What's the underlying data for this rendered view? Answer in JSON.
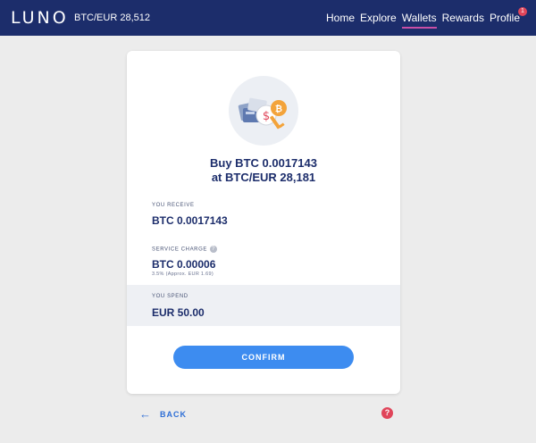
{
  "nav": {
    "logo": "LUNO",
    "ticker": "BTC/EUR 28,512",
    "links": [
      "Home",
      "Explore",
      "Wallets",
      "Rewards",
      "Profile"
    ],
    "active": "Wallets",
    "profile_badge": "1"
  },
  "colors": {
    "nav_bg": "#1c2d6b",
    "accent": "#3d8cf0",
    "heading": "#1c2d6b",
    "active_underline": "#c94fa5",
    "badge": "#e0455a"
  },
  "card": {
    "illustration": "wallet-coins-key-icon",
    "heading_line1": "Buy BTC 0.0017143",
    "heading_line2": "at BTC/EUR 28,181",
    "receive_label": "YOU RECEIVE",
    "receive_value": "BTC 0.0017143",
    "charge_label": "SERVICE CHARGE",
    "charge_value": "BTC 0.00006",
    "charge_note": "3.5% (Approx. EUR 1.69)",
    "spend_label": "YOU SPEND",
    "spend_value": "EUR 50.00",
    "confirm_label": "CONFIRM"
  },
  "footer": {
    "back_label": "BACK",
    "help_icon": "?"
  }
}
